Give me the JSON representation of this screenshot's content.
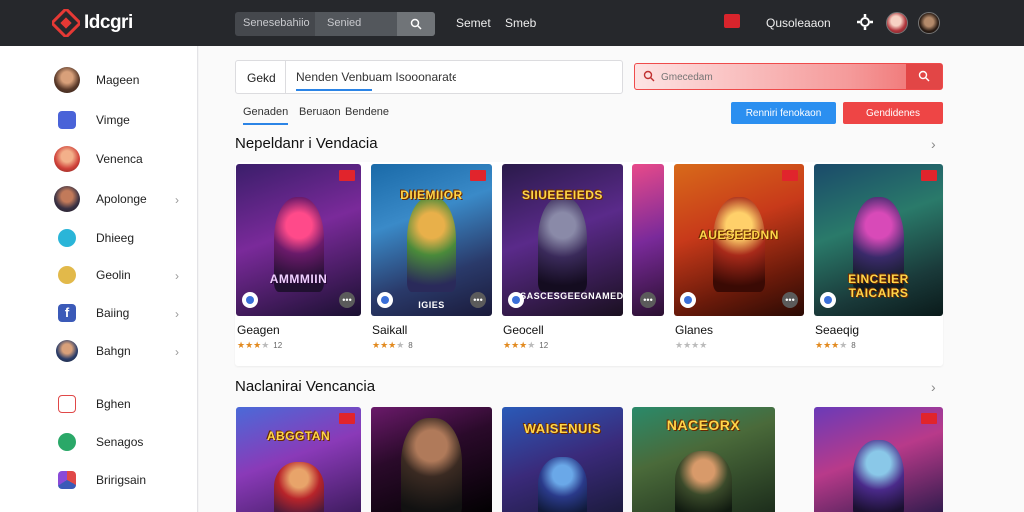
{
  "app": {
    "logo_text": "Idcgri",
    "brand_color": "#e53935"
  },
  "topbar": {
    "search_segment1": "Senesebahiio",
    "search_segment2": "Senied",
    "nav": [
      "Semet",
      "Smeb"
    ],
    "user_name": "Qusoleaaon"
  },
  "sidebar": {
    "items": [
      {
        "label": "Mageen",
        "icon": "avatar-icon",
        "chevron": false
      },
      {
        "label": "Vimge",
        "icon": "blue-tile-icon",
        "chevron": false
      },
      {
        "label": "Venenca",
        "icon": "avatar-icon",
        "chevron": false
      },
      {
        "label": "Apolonge",
        "icon": "avatar-icon",
        "chevron": true
      },
      {
        "label": "Dhieeg",
        "icon": "cyan-circle-icon",
        "chevron": false
      },
      {
        "label": "Geolin",
        "icon": "gold-circle-icon",
        "chevron": true
      },
      {
        "label": "Baiing",
        "icon": "facebook-icon",
        "chevron": true
      },
      {
        "label": "Bahgn",
        "icon": "avatar-icon",
        "chevron": true
      },
      {
        "label": "Bghen",
        "icon": "message-icon",
        "chevron": false
      },
      {
        "label": "Senagos",
        "icon": "green-circle-icon",
        "chevron": false
      },
      {
        "label": "Bririgsain",
        "icon": "colorful-icon",
        "chevron": false
      }
    ]
  },
  "main": {
    "filter": {
      "label": "Gekd",
      "value": "Nenden Venbuam Isooonaratel"
    },
    "red_search_placeholder": "Gmecedam",
    "tabs": [
      "Genaden",
      "Beruaon",
      "Bendene"
    ],
    "blue_button": "Renniri fenokaon",
    "red_button": "Gendidenes",
    "section1_title": "Nepeldanr i Vendacia",
    "section2_title": "Naclanirai Vencancia",
    "row1_cards": [
      {
        "title": "Geagen",
        "banner": "AMMMIIN",
        "rating": 3,
        "rating_text": "12"
      },
      {
        "title": "Saikall",
        "banner": "DIIEMIIOR",
        "rating": 3,
        "rating_text": "8"
      },
      {
        "title": "Geocell",
        "banner": "SIIUEEEIEDS",
        "rating": 3,
        "rating_text": "12"
      },
      {
        "title": "",
        "banner": "",
        "rating": 0,
        "rating_text": ""
      },
      {
        "title": "Glanes",
        "banner": "AUESEEDNN",
        "rating": 0,
        "rating_text": ""
      },
      {
        "title": "Seaeqig",
        "banner": "EINCEIER TAICAIRS",
        "rating": 3,
        "rating_text": "8"
      }
    ],
    "row1_card_captions": [
      "",
      "IGIES",
      "SASCESGEEGNAMED",
      "",
      "",
      ""
    ],
    "row2_cards": [
      {
        "banner": "ABGGTAN"
      },
      {
        "banner": ""
      },
      {
        "banner": "WAISENUIS"
      },
      {
        "banner": "NACEORX"
      },
      {
        "banner": ""
      }
    ]
  }
}
